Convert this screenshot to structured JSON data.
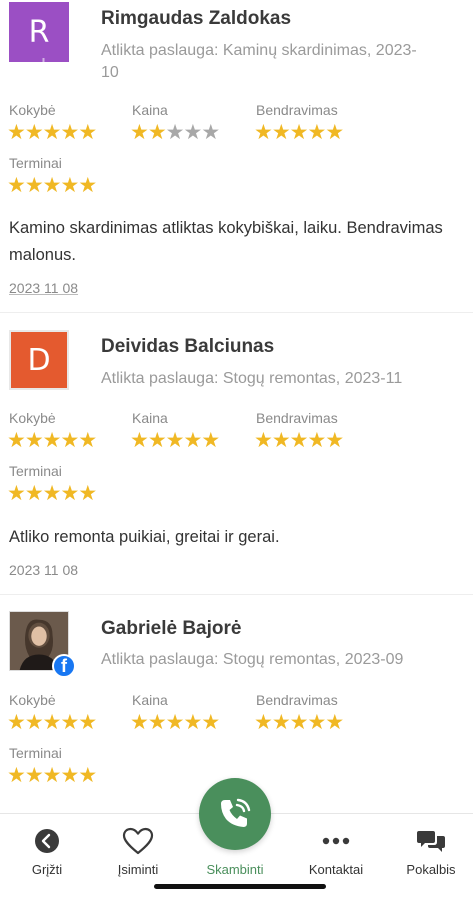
{
  "rating_labels": {
    "quality": "Kokybė",
    "price": "Kaina",
    "communication": "Bendravimas",
    "deadline": "Terminai"
  },
  "reviews": [
    {
      "initial": "R",
      "avatar_color": "#9b4fc4",
      "name": "Rimgaudas Zaldokas",
      "service": "Atlikta paslauga: Kaminų skardinimas, 2023-10",
      "watermark": "skelbiu.lt",
      "ratings": {
        "quality": 5,
        "price": 2,
        "communication": 5,
        "deadline": 5
      },
      "text": "Kamino skardinimas atliktas kokybiškai, laiku. Bendravimas malonus.",
      "date": "2023 11 08"
    },
    {
      "initial": "D",
      "avatar_color": "#e45a2f",
      "name": "Deividas Balciunas",
      "service": "Atlikta paslauga: Stogų remontas, 2023-11",
      "ratings": {
        "quality": 5,
        "price": 5,
        "communication": 5,
        "deadline": 5
      },
      "text": "Atliko remonta puikiai, greitai ir gerai.",
      "date": "2023 11 08"
    },
    {
      "name": "Gabrielė Bajorė",
      "service": "Atlikta paslauga: Stogų remontas, 2023-09",
      "avatar_badge": "facebook-icon",
      "ratings": {
        "quality": 5,
        "price": 5,
        "communication": 5,
        "deadline": 5
      }
    }
  ],
  "bottom_nav": {
    "back": "Grįžti",
    "save": "Įsiminti",
    "call": "Skambinti",
    "contacts": "Kontaktai",
    "chat": "Pokalbis",
    "accent": "#4a8f5c"
  }
}
